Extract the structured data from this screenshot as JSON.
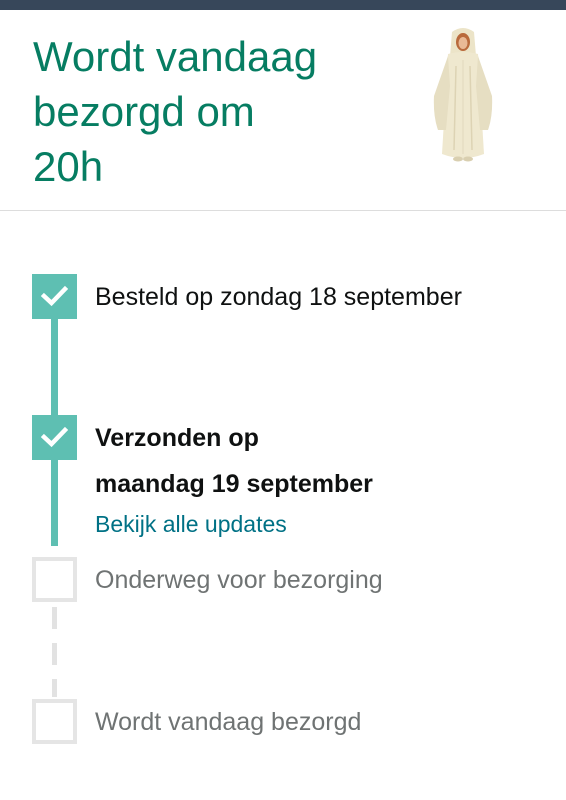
{
  "header": {
    "headline_lines": [
      "Wordt vandaag",
      "bezorgd om",
      "20h"
    ],
    "product_image": "blanket-robe-product-photo"
  },
  "timeline": {
    "steps": [
      {
        "lines": [
          "Besteld op zondag 18 september"
        ],
        "status": "done",
        "icon": "checkmark-icon"
      },
      {
        "lines": [
          "Verzonden op",
          "maandag 19 september"
        ],
        "status": "done",
        "icon": "checkmark-icon",
        "link": "Bekijk alle updates"
      },
      {
        "lines": [
          "Onderweg voor bezorging"
        ],
        "status": "pending"
      },
      {
        "lines": [
          "Wordt vandaag bezorgd"
        ],
        "status": "pending"
      }
    ]
  },
  "colors": {
    "headline": "#067d62",
    "progress": "#5ebfb2",
    "pending": "#e5e5e5",
    "link": "#007185",
    "top_bar": "#37475a"
  }
}
